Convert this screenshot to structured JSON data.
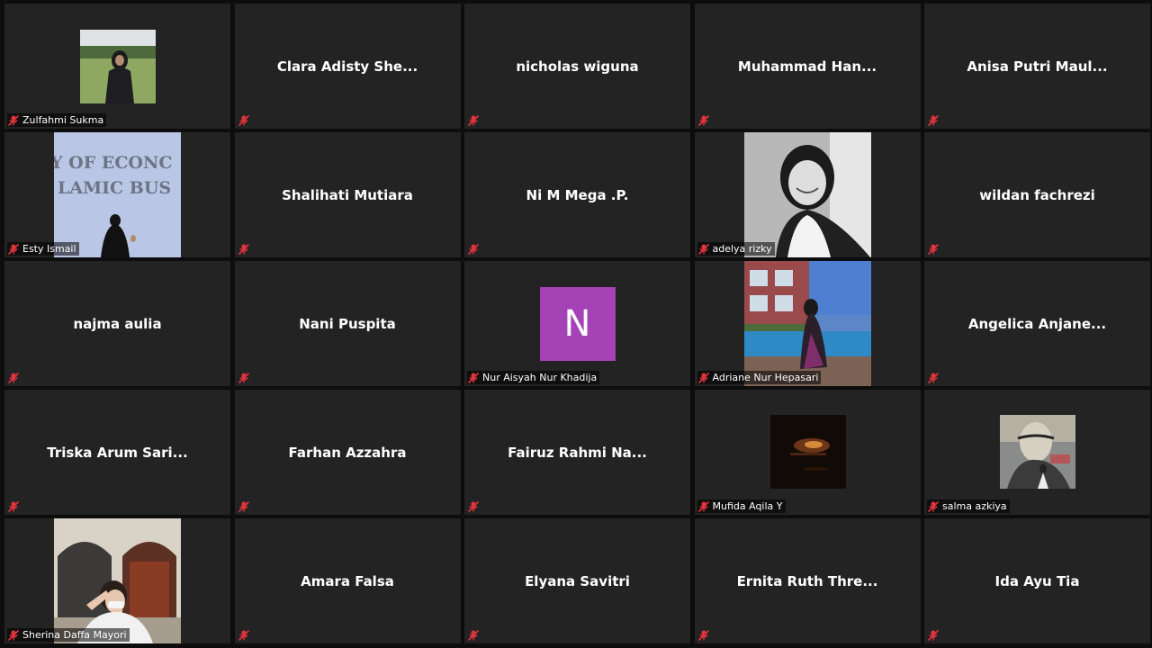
{
  "participants": [
    {
      "name": "Zulfahmi Sukma",
      "label": "Zulfahmi Sukma",
      "video": "field-girl"
    },
    {
      "name": "Clara Adisty She...",
      "label": "",
      "video": ""
    },
    {
      "name": "nicholas wiguna",
      "label": "",
      "video": ""
    },
    {
      "name": "Muhammad  Han...",
      "label": "",
      "video": ""
    },
    {
      "name": "Anisa  Putri  Maul...",
      "label": "",
      "video": ""
    },
    {
      "name": "Esty Ismail",
      "label": "Esty Ismail",
      "video": "economics-wall"
    },
    {
      "name": "Shalihati Mutiara",
      "label": "",
      "video": ""
    },
    {
      "name": "Ni M Mega .P.",
      "label": "",
      "video": ""
    },
    {
      "name": "adelya rizky",
      "label": "adelya rizky",
      "video": "portrait-bw"
    },
    {
      "name": "wildan fachrezi",
      "label": "",
      "video": ""
    },
    {
      "name": "najma aulia",
      "label": "",
      "video": ""
    },
    {
      "name": "Nani Puspita",
      "label": "",
      "video": ""
    },
    {
      "name": "Nur Aisyah Nur Khadija",
      "label": "Nur Aisyah Nur Khadija",
      "video": "avatar",
      "avatar_letter": "N",
      "avatar_color": "#a542b5"
    },
    {
      "name": "Adriane Nur Hepasari",
      "label": "Adriane Nur Hepasari",
      "video": "pool"
    },
    {
      "name": "Angelica  Anjane...",
      "label": "",
      "video": ""
    },
    {
      "name": "Triska  Arum  Sari...",
      "label": "",
      "video": ""
    },
    {
      "name": "Farhan Azzahra",
      "label": "",
      "video": ""
    },
    {
      "name": "Fairuz  Rahmi  Na...",
      "label": "",
      "video": ""
    },
    {
      "name": "Mufida Aqila Y",
      "label": "Mufida Aqila Y",
      "video": "dark-room"
    },
    {
      "name": "salma azkiya",
      "label": "salma azkiya",
      "video": "mural"
    },
    {
      "name": "Sherina Daffa Mayori",
      "label": "Sherina Daffa Mayori",
      "video": "arches"
    },
    {
      "name": "Amara Falsa",
      "label": "",
      "video": ""
    },
    {
      "name": "Elyana Savitri",
      "label": "",
      "video": ""
    },
    {
      "name": "Ernita  Ruth  Thre...",
      "label": "",
      "video": ""
    },
    {
      "name": "Ida Ayu Tia",
      "label": "",
      "video": ""
    }
  ],
  "photo_texts": {
    "economics_line1": "Y OF ECONC",
    "economics_line2": "LAMIC BUS"
  },
  "colors": {
    "tile_bg": "#232323",
    "mute_icon": "#e0333c",
    "background": "#0d0d0d"
  },
  "icons": {
    "mute": "microphone-muted-icon"
  }
}
